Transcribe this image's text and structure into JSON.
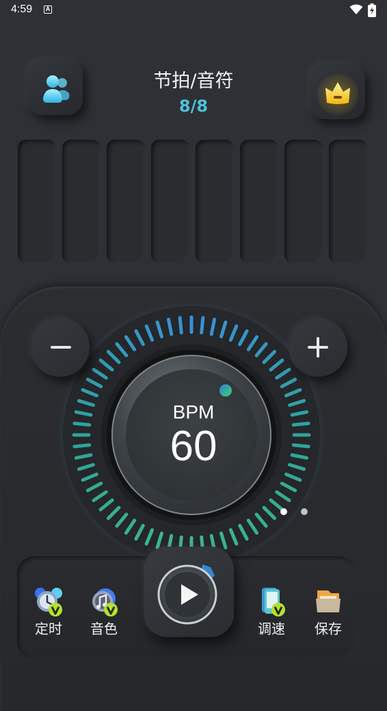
{
  "status_bar": {
    "time": "4:59",
    "notification_glyph": "A"
  },
  "header": {
    "title": "节拍/音符",
    "beat_value": "8/8"
  },
  "beat_bars": {
    "count": 8
  },
  "tempo": {
    "label": "BPM",
    "value": "60"
  },
  "pager": {
    "count": 2,
    "active": 1
  },
  "toolbar": {
    "timer_label": "定时",
    "sound_label": "音色",
    "speed_label": "调速",
    "save_label": "保存"
  },
  "icons": {
    "users": "users-icon",
    "crown": "crown-icon",
    "minus": "minus-icon",
    "plus": "plus-icon",
    "play": "play-icon",
    "timer": "timer-icon",
    "sound": "music-note-icon",
    "speed": "speed-icon",
    "save": "folder-icon"
  },
  "colors": {
    "background": "#2e3035",
    "accent_cyan": "#4ec2d8",
    "tick_blue": "#3a8fd8",
    "tick_teal": "#2fa39a",
    "tick_green": "#3fb88a",
    "crown_yellow": "#f5c518",
    "vip_green": "#b6e12b"
  }
}
